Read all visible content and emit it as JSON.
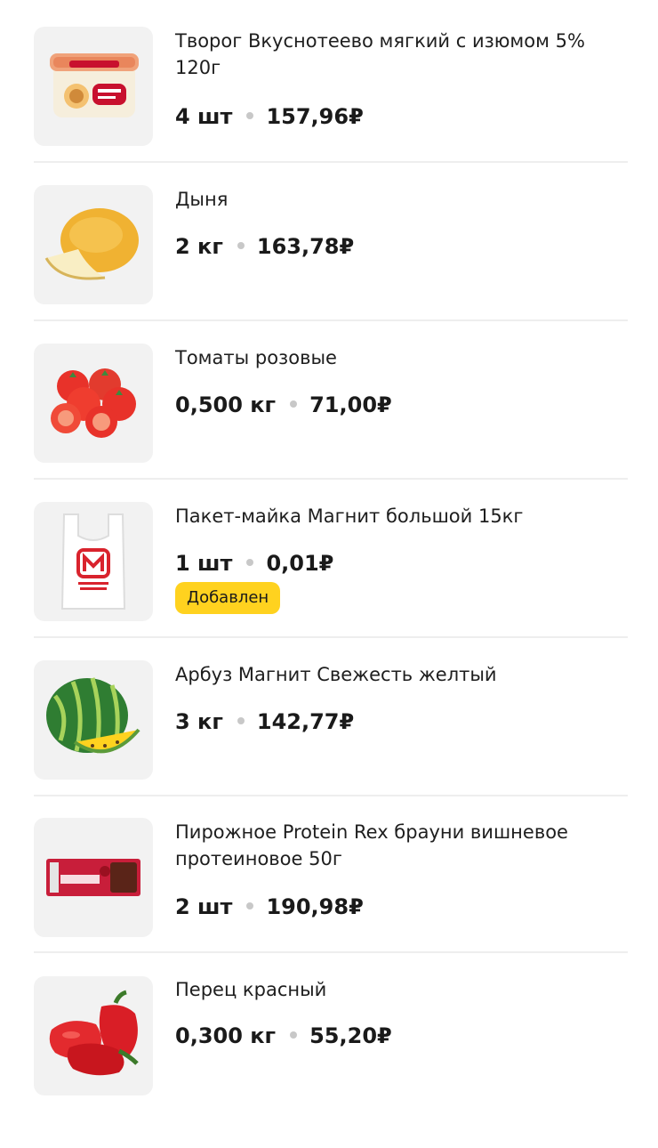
{
  "items": [
    {
      "title": "Творог Вкуснотеево мягкий с изюмом 5% 120г",
      "qty": "4 шт",
      "price": "157,96₽",
      "image": "cottage-cheese-icon"
    },
    {
      "title": "Дыня",
      "qty": "2 кг",
      "price": "163,78₽",
      "image": "melon-icon"
    },
    {
      "title": "Томаты розовые",
      "qty": "0,500 кг",
      "price": "71,00₽",
      "image": "tomatoes-icon"
    },
    {
      "title": "Пакет-майка Магнит большой 15кг",
      "qty": "1 шт",
      "price": "0,01₽",
      "badge": "Добавлен",
      "image": "shopping-bag-icon"
    },
    {
      "title": "Арбуз Магнит Свежесть желтый",
      "qty": "3 кг",
      "price": "142,77₽",
      "image": "watermelon-icon"
    },
    {
      "title": "Пирожное Protein Rex брауни вишневое протеиновое 50г",
      "qty": "2 шт",
      "price": "190,98₽",
      "image": "brownie-bar-icon"
    },
    {
      "title": "Перец красный",
      "qty": "0,300 кг",
      "price": "55,20₽",
      "image": "red-pepper-icon"
    }
  ],
  "colors": {
    "badge_bg": "#ffd21f",
    "thumb_bg": "#f2f2f2",
    "divider": "#eeeeee"
  }
}
